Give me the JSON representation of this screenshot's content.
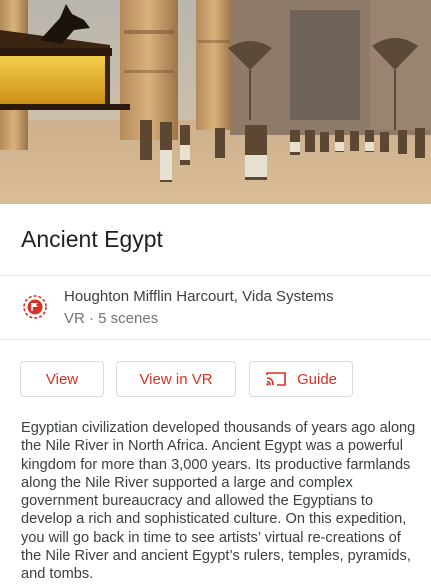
{
  "tour": {
    "title": "Ancient Egypt",
    "provider": "Houghton Mifflin Harcourt, Vida Systems",
    "meta": "VR · 5 scenes",
    "description": "Egyptian civilization developed thousands of years ago along the Nile River in North Africa. Ancient Egypt was a powerful kingdom for more than 3,000 years. Its productive farmlands along the Nile River supported a large and complex government bureaucracy and allowed the Egyptians to develop a rich and sophisticated culture. On this expedition, you will go back in time to see artists’ virtual re-creations of the Nile River and ancient Egypt’s rulers, temples, pyramids, and tombs."
  },
  "actions": {
    "view_label": "View",
    "view_vr_label": "View in VR",
    "guide_label": "Guide"
  },
  "icons": {
    "provider": "flag-pin-icon",
    "guide": "cast-icon"
  },
  "colors": {
    "accent": "#d93025",
    "border": "#dadce0",
    "text_primary": "#202124",
    "text_secondary": "#70757a"
  }
}
